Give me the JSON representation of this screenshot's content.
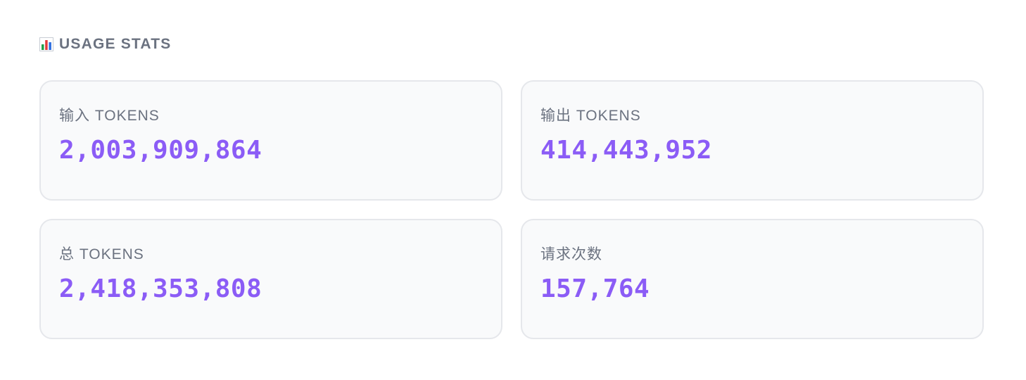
{
  "section": {
    "icon": "bar-chart-icon",
    "title": "USAGE STATS"
  },
  "colors": {
    "accent": "#8b5cf6",
    "label": "#6b7280",
    "card_bg": "#f9fafb",
    "card_border": "#e5e7eb"
  },
  "stats": [
    {
      "label": "输入 TOKENS",
      "value": "2,003,909,864"
    },
    {
      "label": "输出 TOKENS",
      "value": "414,443,952"
    },
    {
      "label": "总 TOKENS",
      "value": "2,418,353,808"
    },
    {
      "label": "请求次数",
      "value": "157,764"
    }
  ]
}
